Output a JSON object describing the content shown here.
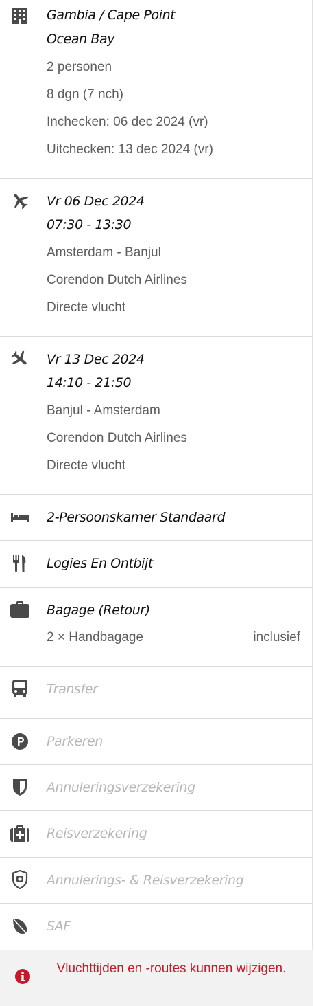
{
  "hotel": {
    "icon": "building-icon",
    "destination": "Gambia / Cape Point",
    "name": "Ocean Bay",
    "persons": "2 personen",
    "duration": "8 dgn (7 nch)",
    "checkin": "Inchecken: 06 dec 2024 (vr)",
    "checkout": "Uitchecken: 13 dec 2024 (vr)"
  },
  "outbound": {
    "icon": "airplane-takeoff-icon",
    "date": "Vr 06 Dec 2024",
    "time": "07:30 - 13:30",
    "route": "Amsterdam - Banjul",
    "airline": "Corendon Dutch Airlines",
    "type": "Directe vlucht"
  },
  "return": {
    "icon": "airplane-landing-icon",
    "date": "Vr 13 Dec 2024",
    "time": "14:10 - 21:50",
    "route": "Banjul - Amsterdam",
    "airline": "Corendon Dutch Airlines",
    "type": "Directe vlucht"
  },
  "room": {
    "icon": "bed-icon",
    "label": "2-Persoonskamer Standaard"
  },
  "board": {
    "icon": "cutlery-icon",
    "label": "Logies En Ontbijt"
  },
  "baggage": {
    "icon": "suitcase-icon",
    "label": "Bagage (Retour)",
    "item": "2 × Handbagage",
    "status": "inclusief"
  },
  "extras": [
    {
      "icon": "bus-icon",
      "label": "Transfer"
    },
    {
      "icon": "parking-icon",
      "label": "Parkeren"
    },
    {
      "icon": "shield-icon",
      "label": "Annuleringsverzekering"
    },
    {
      "icon": "medical-kit-icon",
      "label": "Reisverzekering"
    },
    {
      "icon": "shield-medical-icon",
      "label": "Annulerings- & Reisverzekering"
    },
    {
      "icon": "leaf-icon",
      "label": "SAF"
    }
  ],
  "notice": {
    "icon": "info-icon",
    "text": "Vluchttijden en -routes kunnen wijzigen."
  },
  "colors": {
    "notice": "#c8192b",
    "icon": "#4a4a4a",
    "muted": "#b7b7b7"
  }
}
